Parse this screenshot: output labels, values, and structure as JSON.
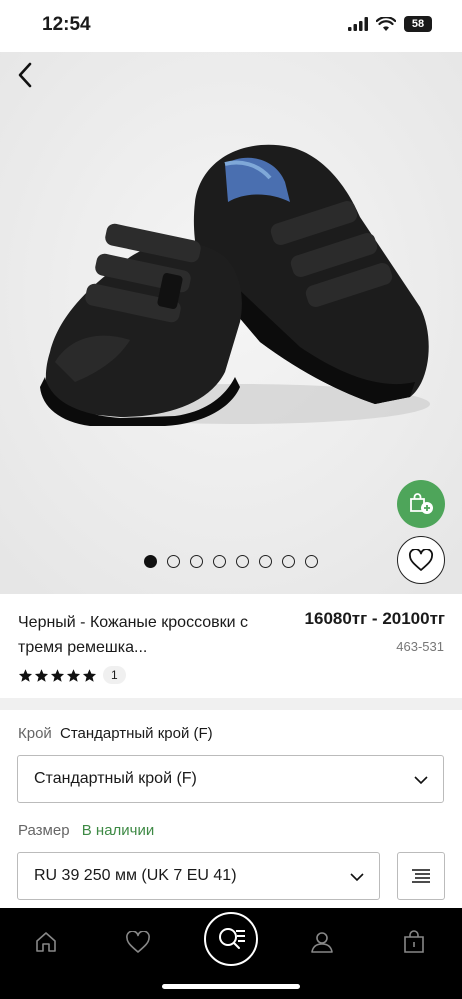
{
  "status_bar": {
    "time": "12:54",
    "battery": "58"
  },
  "gallery": {
    "image_count": 8,
    "active_index": 0
  },
  "product": {
    "name": "Черный - Кожаные кроссовки с тремя ремешка...",
    "price": "16080тг - 20100тг",
    "code": "463-531",
    "rating": 5,
    "review_count": "1"
  },
  "fit": {
    "label": "Крой",
    "value": "Стандартный крой (F)",
    "selected": "Стандартный крой (F)"
  },
  "size": {
    "label": "Размер",
    "stock_status": "В наличии",
    "selected": "RU 39 250 мм (UK 7 EU 41)"
  },
  "colors": {
    "accent_green": "#4ea55a",
    "stock_green": "#3e8a45",
    "tab_bar": "#000000"
  }
}
